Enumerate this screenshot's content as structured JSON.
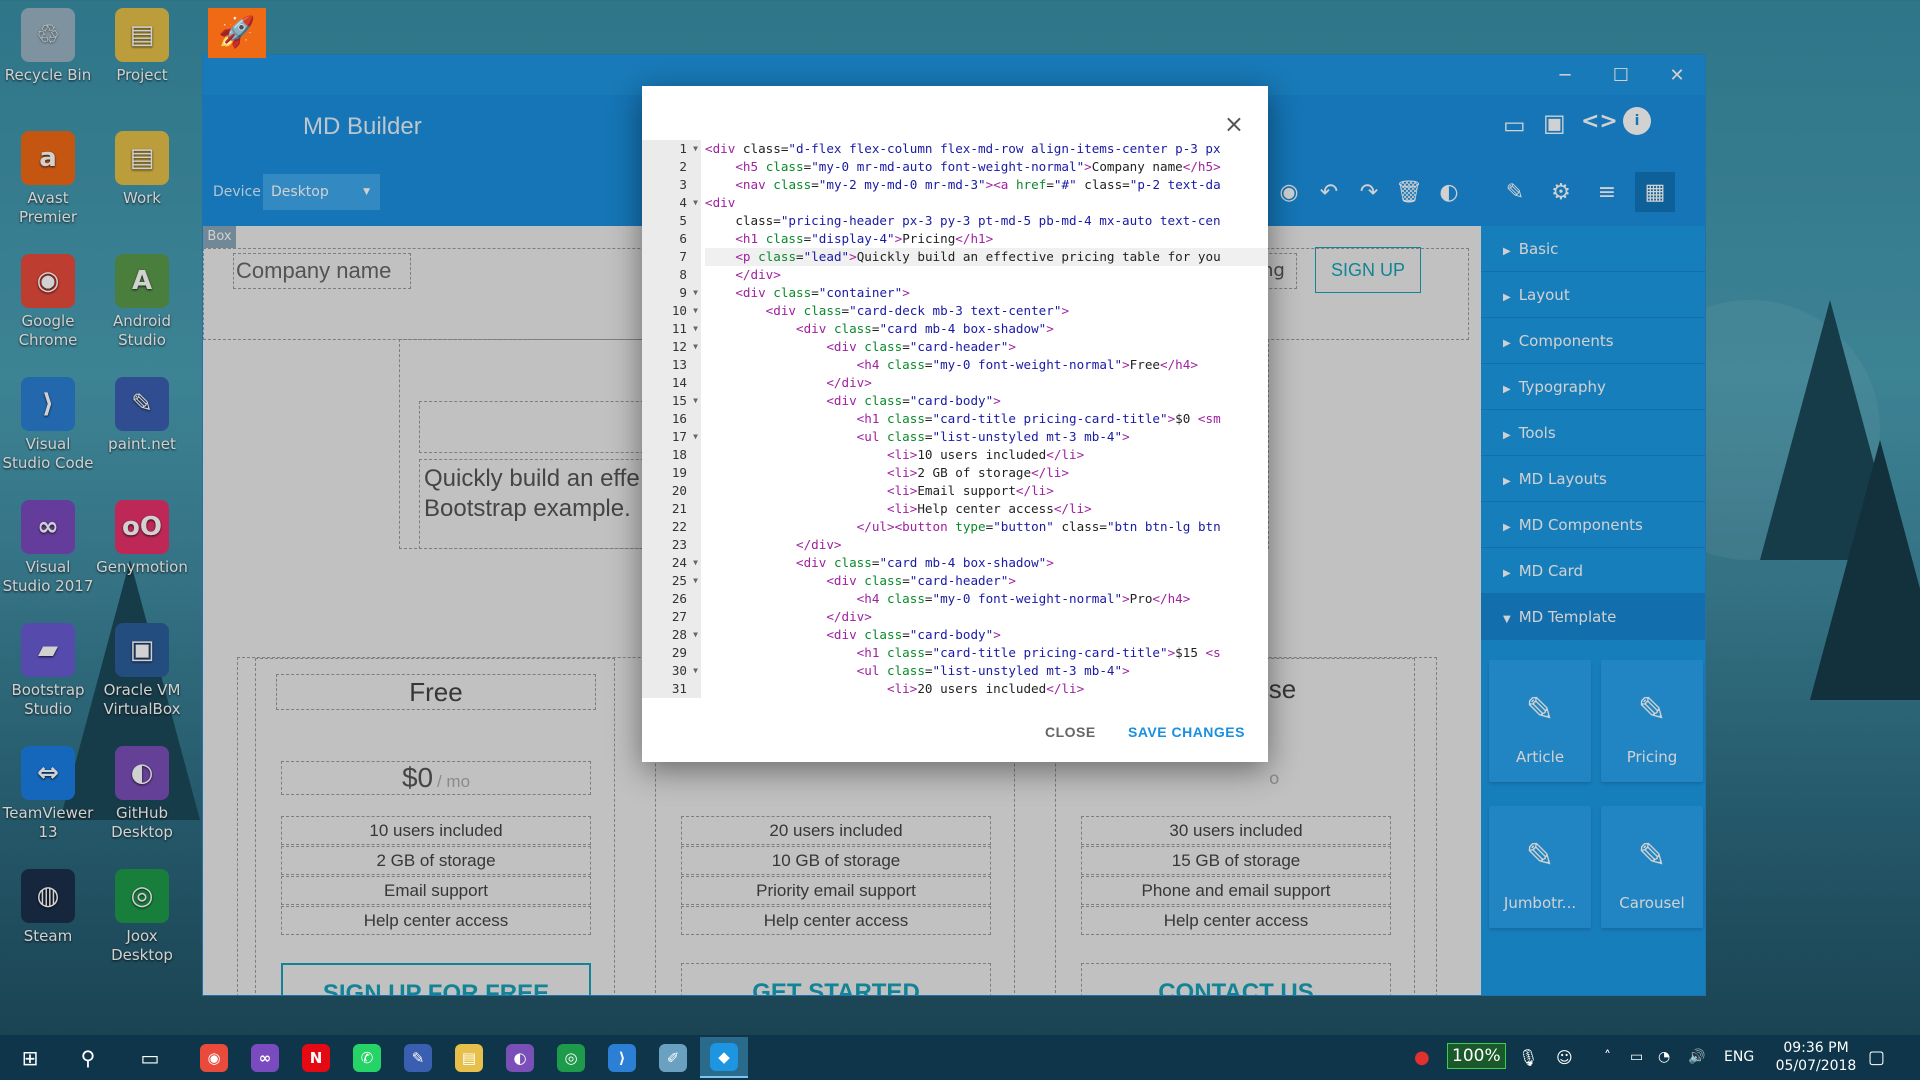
{
  "desktop": {
    "icons": [
      {
        "label": "Recycle Bin",
        "glyph": "♲",
        "color": "#9bb3c2",
        "icon": "recycle-bin-icon"
      },
      {
        "label": "Project",
        "glyph": "▤",
        "color": "#e6c04a",
        "icon": "folder-icon"
      },
      {
        "label": "Avast Premier",
        "glyph": "a",
        "color": "#f06a16",
        "icon": "avast-icon"
      },
      {
        "label": "Work",
        "glyph": "▤",
        "color": "#e6c04a",
        "icon": "folder-icon"
      },
      {
        "label": "Google Chrome",
        "glyph": "◉",
        "color": "#e84b3c",
        "icon": "chrome-icon"
      },
      {
        "label": "Android Studio",
        "glyph": "A",
        "color": "#5b9a4b",
        "icon": "android-studio-icon"
      },
      {
        "label": "Visual Studio Code",
        "glyph": "⟩",
        "color": "#2b7fd4",
        "icon": "vscode-icon"
      },
      {
        "label": "paint.net",
        "glyph": "✎",
        "color": "#3a5fb0",
        "icon": "paintnet-icon"
      },
      {
        "label": "Visual Studio 2017",
        "glyph": "∞",
        "color": "#7a4bbf",
        "icon": "visual-studio-icon"
      },
      {
        "label": "Genymotion",
        "glyph": "oO",
        "color": "#e8316b",
        "icon": "genymotion-icon"
      },
      {
        "label": "Bootstrap Studio",
        "glyph": "▰",
        "color": "#6a5bd4",
        "icon": "bootstrap-studio-icon"
      },
      {
        "label": "Oracle VM VirtualBox",
        "glyph": "▣",
        "color": "#2c5e9c",
        "icon": "virtualbox-icon"
      },
      {
        "label": "TeamViewer 13",
        "glyph": "⇔",
        "color": "#1a7ee6",
        "icon": "teamviewer-icon"
      },
      {
        "label": "GitHub Desktop",
        "glyph": "◐",
        "color": "#7b4fb8",
        "icon": "github-desktop-icon"
      },
      {
        "label": "Steam",
        "glyph": "◍",
        "color": "#1b2f4a",
        "icon": "steam-icon"
      },
      {
        "label": "Joox Desktop",
        "glyph": "◎",
        "color": "#1d9a4a",
        "icon": "joox-icon"
      }
    ]
  },
  "app": {
    "title": "MD Builder",
    "device_label": "Device",
    "device_value": "Desktop",
    "box_label": "Box",
    "sidebar": [
      {
        "label": "Basic",
        "expanded": false
      },
      {
        "label": "Layout",
        "expanded": false
      },
      {
        "label": "Components",
        "expanded": false
      },
      {
        "label": "Typography",
        "expanded": false
      },
      {
        "label": "Tools",
        "expanded": false
      },
      {
        "label": "MD Layouts",
        "expanded": false
      },
      {
        "label": "MD Components",
        "expanded": false
      },
      {
        "label": "MD Card",
        "expanded": false
      },
      {
        "label": "MD Template",
        "expanded": true
      }
    ],
    "templates": [
      "Article",
      "Pricing",
      "Jumbotr...",
      "Carousel"
    ]
  },
  "preview": {
    "company": "Company name",
    "nav_link": "cing",
    "signup": "SIGN UP",
    "lead_line1": "Quickly build an effe",
    "lead_line2": "Bootstrap example.",
    "plan1": {
      "title": "Free",
      "price": "$0",
      "per": "/ mo",
      "features": [
        "10 users included",
        "2 GB of storage",
        "Email support",
        "Help center access"
      ],
      "button": "SIGN UP FOR FREE"
    },
    "plan2": {
      "features": [
        "20 users included",
        "10 GB of storage",
        "Priority email support",
        "Help center access"
      ],
      "button": "GET STARTED"
    },
    "plan3": {
      "title_fragment": "ise",
      "price_fragment": "o",
      "features": [
        "30 users included",
        "15 GB of storage",
        "Phone and email support",
        "Help center access"
      ],
      "button": "CONTACT US"
    }
  },
  "modal": {
    "close_x": "×",
    "close_btn": "CLOSE",
    "save_btn": "SAVE CHANGES",
    "line_numbers": [
      "1",
      "2",
      "3",
      "4",
      "5",
      "6",
      "7",
      "8",
      "9",
      "10",
      "11",
      "12",
      "13",
      "14",
      "15",
      "16",
      "17",
      "18",
      "19",
      "20",
      "21",
      "22",
      "23",
      "24",
      "25",
      "26",
      "27",
      "28",
      "29",
      "30",
      "31"
    ],
    "folds": [
      1,
      4,
      9,
      10,
      11,
      12,
      15,
      17,
      24,
      25,
      28,
      30
    ],
    "code": [
      "<div class=\"d-flex flex-column flex-md-row align-items-center p-3 px",
      "    <h5 class=\"my-0 mr-md-auto font-weight-normal\">Company name</h5>",
      "    <nav class=\"my-2 my-md-0 mr-md-3\"><a href=\"#\" class=\"p-2 text-da",
      "<div",
      "    class=\"pricing-header px-3 py-3 pt-md-5 pb-md-4 mx-auto text-cen",
      "    <h1 class=\"display-4\">Pricing</h1>",
      "    <p class=\"lead\">Quickly build an effective pricing table for you",
      "    </div>",
      "    <div class=\"container\">",
      "        <div class=\"card-deck mb-3 text-center\">",
      "            <div class=\"card mb-4 box-shadow\">",
      "                <div class=\"card-header\">",
      "                    <h4 class=\"my-0 font-weight-normal\">Free</h4>",
      "                </div>",
      "                <div class=\"card-body\">",
      "                    <h1 class=\"card-title pricing-card-title\">$0 <sm",
      "                    <ul class=\"list-unstyled mt-3 mb-4\">",
      "                        <li>10 users included</li>",
      "                        <li>2 GB of storage</li>",
      "                        <li>Email support</li>",
      "                        <li>Help center access</li>",
      "                    </ul><button type=\"button\" class=\"btn btn-lg btn",
      "            </div>",
      "            <div class=\"card mb-4 box-shadow\">",
      "                <div class=\"card-header\">",
      "                    <h4 class=\"my-0 font-weight-normal\">Pro</h4>",
      "                </div>",
      "                <div class=\"card-body\">",
      "                    <h1 class=\"card-title pricing-card-title\">$15 <s",
      "                    <ul class=\"list-unstyled mt-3 mb-4\">",
      "                        <li>20 users included</li>"
    ],
    "active_line": 7
  },
  "taskbar": {
    "apps": [
      {
        "icon": "chrome-icon",
        "glyph": "◉",
        "color": "#e84b3c"
      },
      {
        "icon": "visual-studio-icon",
        "glyph": "∞",
        "color": "#7a4bbf"
      },
      {
        "icon": "netflix-icon",
        "glyph": "N",
        "color": "#e50914"
      },
      {
        "icon": "whatsapp-icon",
        "glyph": "✆",
        "color": "#25d366"
      },
      {
        "icon": "paintnet-icon",
        "glyph": "✎",
        "color": "#3a5fb0"
      },
      {
        "icon": "file-explorer-icon",
        "glyph": "▤",
        "color": "#e6c04a"
      },
      {
        "icon": "github-desktop-icon",
        "glyph": "◐",
        "color": "#7b4fb8"
      },
      {
        "icon": "joox-icon",
        "glyph": "◎",
        "color": "#1d9a4a"
      },
      {
        "icon": "vscode-icon",
        "glyph": "⟩",
        "color": "#2b7fd4"
      },
      {
        "icon": "notepad-icon",
        "glyph": "✐",
        "color": "#6aa0c0"
      },
      {
        "icon": "md-builder-icon",
        "glyph": "◆",
        "color": "#1e95e1"
      }
    ],
    "battery": "100%",
    "lang": "ENG",
    "time": "09:36 PM",
    "date": "05/07/2018"
  },
  "colors": {
    "primary": "#1a8fdf",
    "accent": "#17a2b8",
    "link": "#1a8fdf"
  }
}
